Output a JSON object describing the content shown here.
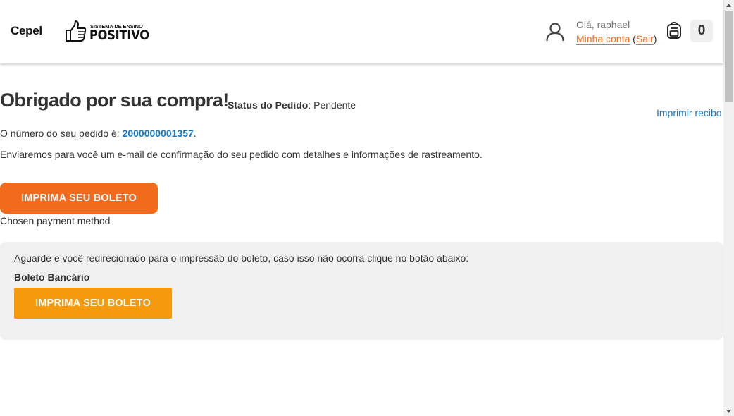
{
  "header": {
    "store_name": "Cepel",
    "logo_small": "SISTEMA DE ENSINO",
    "logo_big": "POSITIVO",
    "user_icon": "user-icon",
    "greeting": "Olá, raphael",
    "my_account": "Minha conta",
    "logout": "Sair",
    "cart_icon": "backpack-icon",
    "cart_count": "0"
  },
  "main": {
    "title": "Obrigado por sua compra!",
    "status_label": "Status do Pedido",
    "status_value": "Pendente",
    "print_receipt": "Imprimir recibo",
    "order_number_prefix": "O número do seu pedido é: ",
    "order_number": "2000000001357",
    "email_note": "Enviaremos para você um e-mail de confirmação do seu pedido com detalhes e informações de rastreamento.",
    "print_boleto_button": "IMPRIMA SEU BOLETO",
    "payment_method_label": "Chosen payment method"
  },
  "boleto_panel": {
    "redirect_message": "Aguarde e você redirecionado para o impressão do boleto, caso isso não ocorra clique no botão abaixo:",
    "title": "Boleto Bancário",
    "print_button": "IMPRIMA SEU BOLETO"
  },
  "colors": {
    "accent_orange": "#f26b1d",
    "button_amber": "#f49a0c",
    "link_blue": "#1979c3",
    "panel_gray": "#f0f0f0"
  }
}
